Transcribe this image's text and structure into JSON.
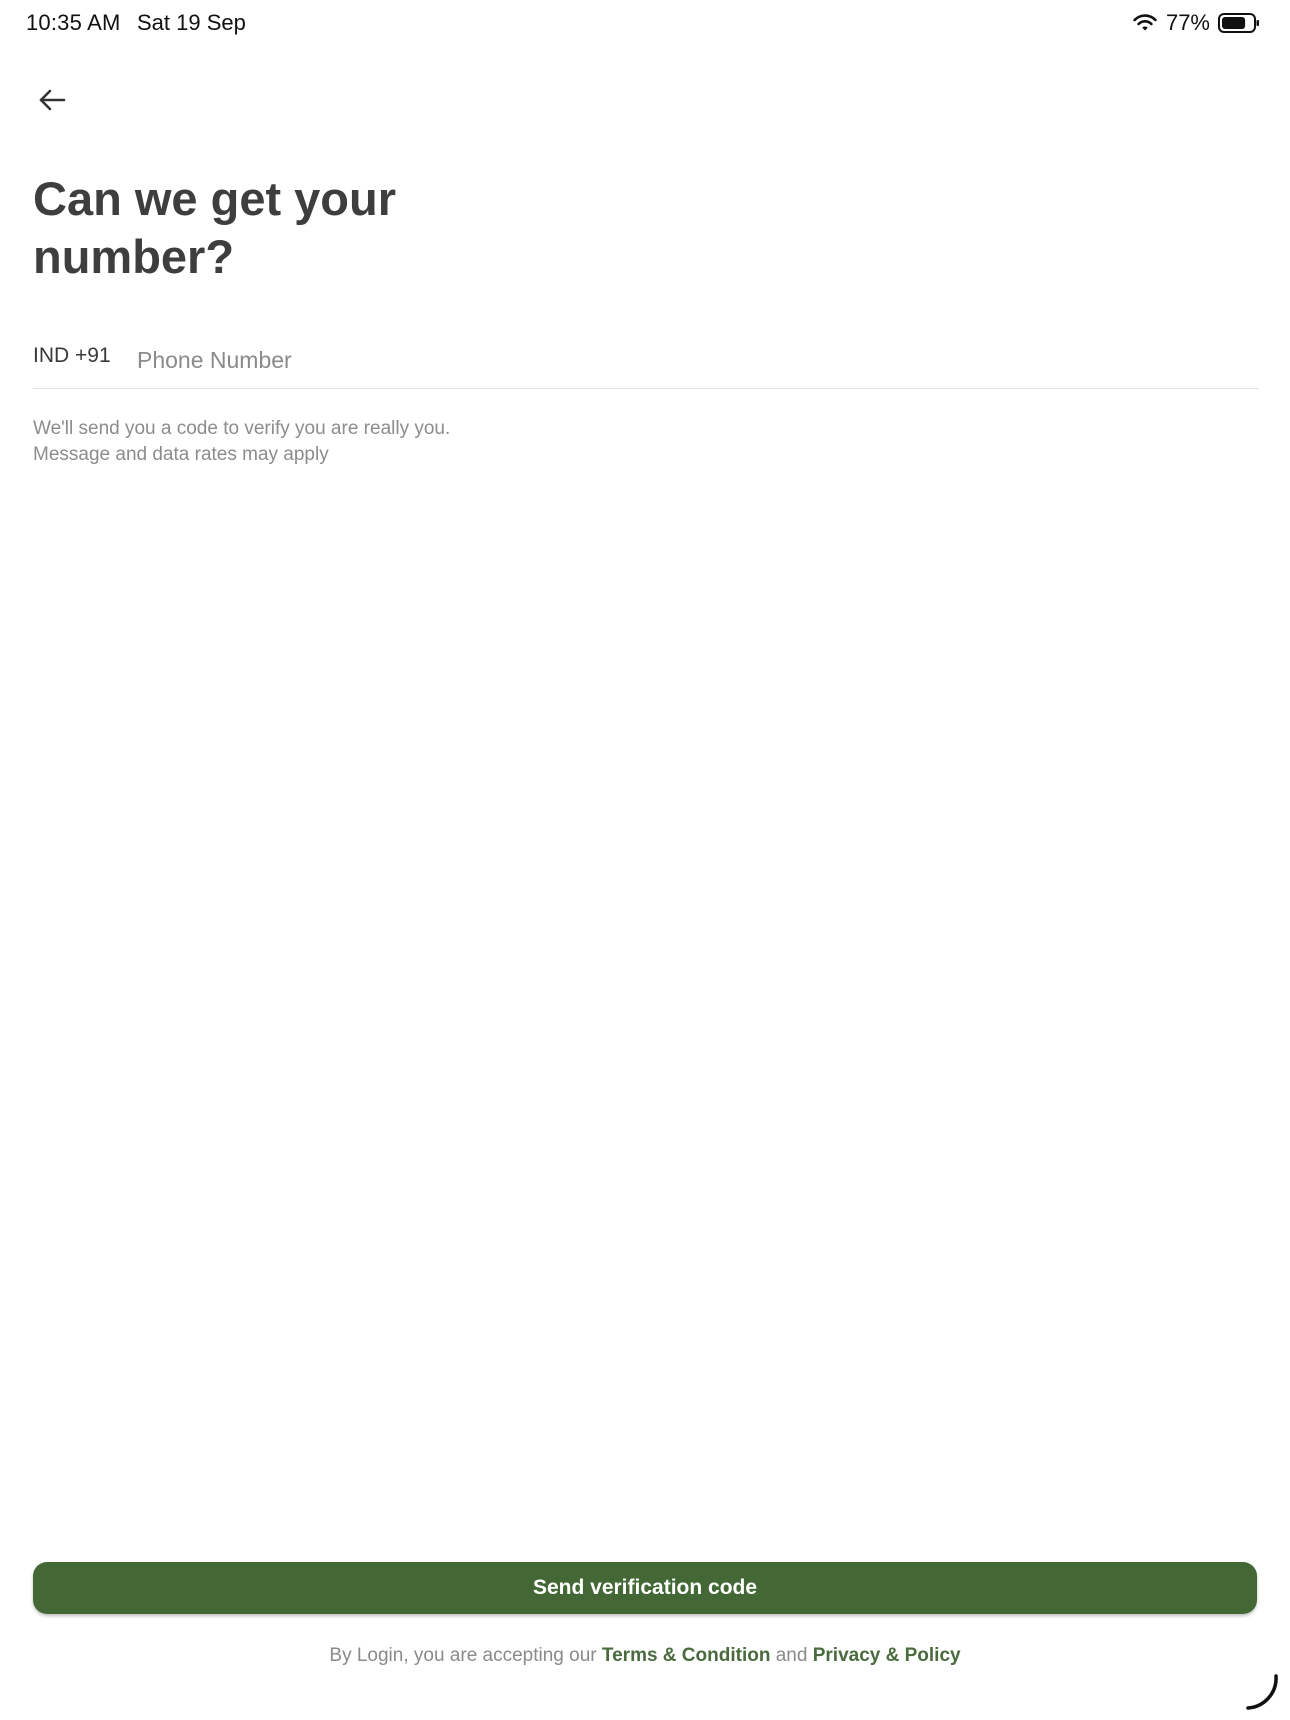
{
  "status_bar": {
    "time": "10:35 AM",
    "date": "Sat 19 Sep",
    "battery_percent": "77%",
    "battery_level": 0.77,
    "icons": [
      "wifi-icon",
      "battery-icon"
    ]
  },
  "header": {
    "back_icon": "arrow-left-icon",
    "title": "Can we get your number?"
  },
  "phone": {
    "country_code": "IND +91",
    "placeholder": "Phone Number",
    "value": ""
  },
  "helper": {
    "line1": "We'll send you a code to verify you are really you.",
    "line2": "Message and data rates may apply"
  },
  "actions": {
    "send_label": "Send verification code"
  },
  "legal": {
    "prefix": "By Login, you are accepting our",
    "terms": "Terms & Condition",
    "and": "and",
    "privacy": "Privacy & Policy"
  },
  "colors": {
    "accent": "#436836",
    "link": "#4a6b3d",
    "title": "#3e3e3e",
    "muted": "#8c8c8c"
  }
}
